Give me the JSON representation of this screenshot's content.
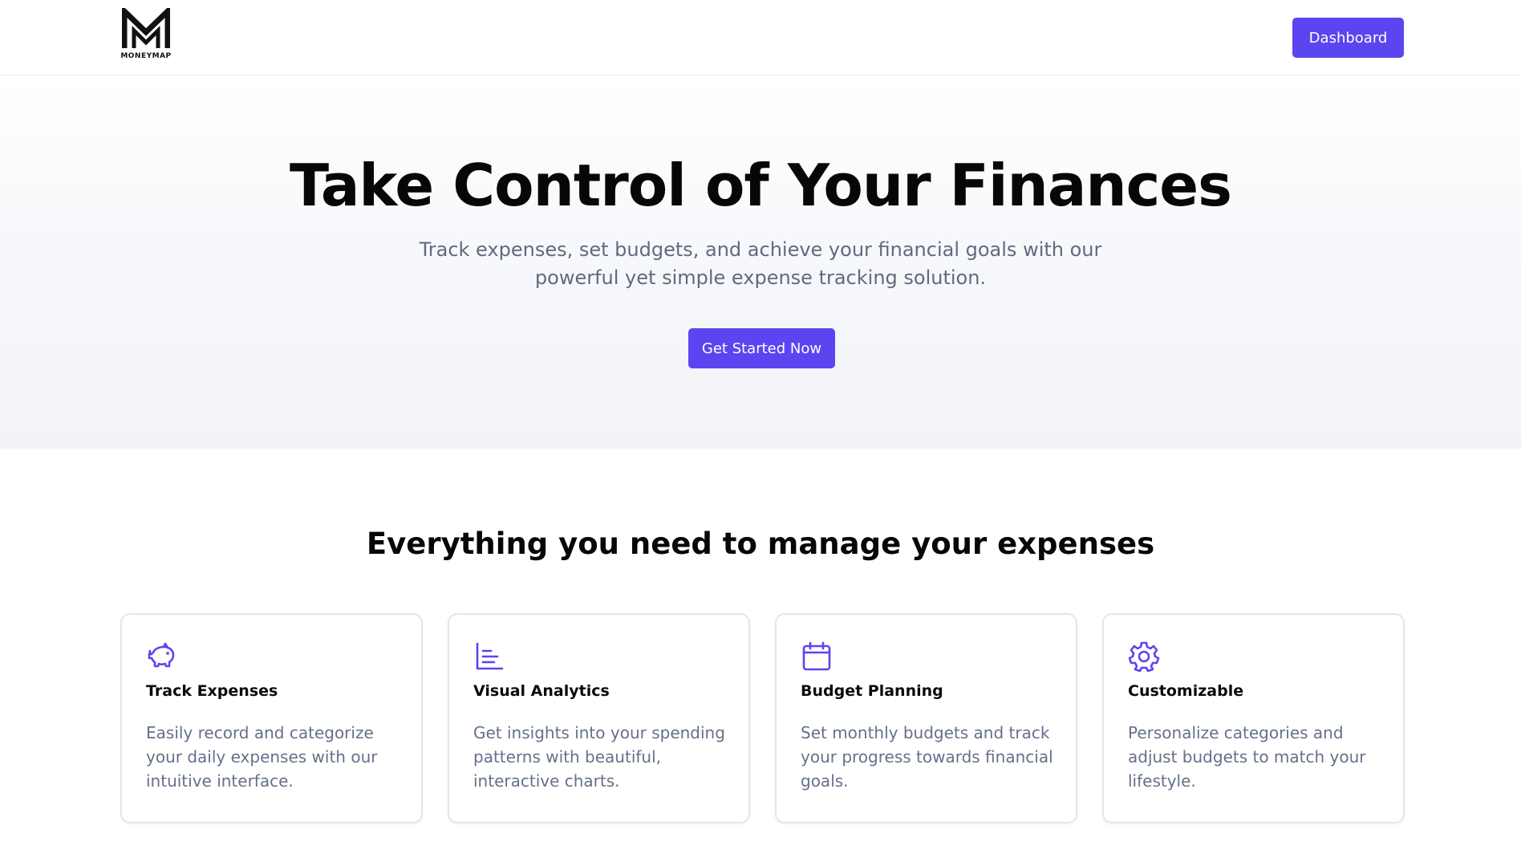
{
  "brand": {
    "logo_text": "MONEYMAP",
    "accent_color": "#5b45f0"
  },
  "header": {
    "dashboard_label": "Dashboard"
  },
  "hero": {
    "title": "Take Control of Your Finances",
    "subtitle": "Track expenses, set budgets, and achieve your financial goals with our powerful yet simple expense tracking solution.",
    "cta_label": "Get Started Now"
  },
  "features": {
    "title": "Everything you need to manage your expenses",
    "cards": [
      {
        "icon": "piggy-bank-icon",
        "title": "Track Expenses",
        "description": "Easily record and categorize your daily expenses with our intuitive interface."
      },
      {
        "icon": "bar-chart-icon",
        "title": "Visual Analytics",
        "description": "Get insights into your spending patterns with beautiful, interactive charts."
      },
      {
        "icon": "calendar-icon",
        "title": "Budget Planning",
        "description": "Set monthly budgets and track your progress towards financial goals."
      },
      {
        "icon": "gear-icon",
        "title": "Customizable",
        "description": "Personalize categories and adjust budgets to match your lifestyle."
      }
    ]
  }
}
